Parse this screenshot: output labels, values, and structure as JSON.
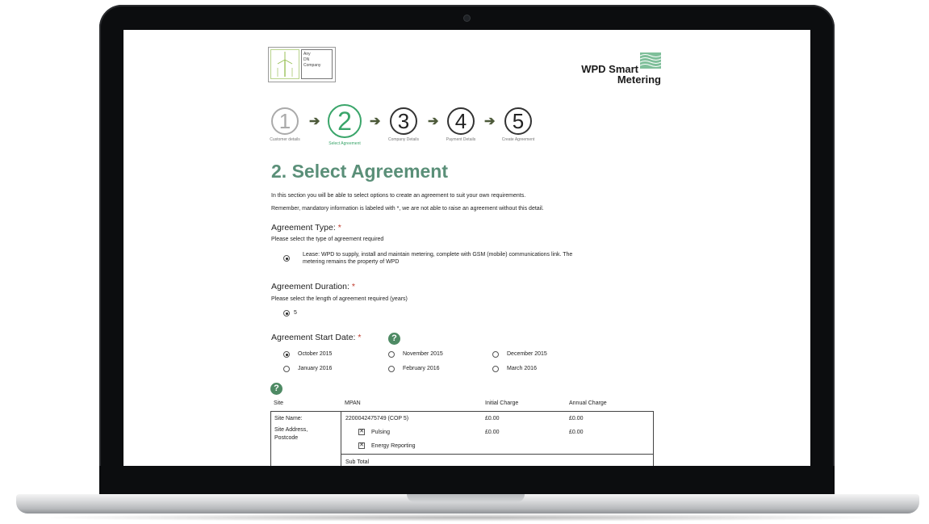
{
  "brand": {
    "left_logo_text": [
      "Any",
      "DN",
      "Company"
    ],
    "right_logo_line1": "WPD Smart",
    "right_logo_line2": "Metering"
  },
  "steps": [
    {
      "num": "1",
      "label": "Customer details",
      "state": "done"
    },
    {
      "num": "2",
      "label": "Select Agreement",
      "state": "active"
    },
    {
      "num": "3",
      "label": "Company Details",
      "state": "todo"
    },
    {
      "num": "4",
      "label": "Payment Details",
      "state": "todo"
    },
    {
      "num": "5",
      "label": "Create Agreement",
      "state": "todo"
    }
  ],
  "page_title": "2. Select Agreement",
  "intro": {
    "line1": "In this section you will be able to select options to create an agreement to suit your own requirements.",
    "line2": "Remember, mandatory information is labeled with *, we are not able to raise an agreement without this detail."
  },
  "agreement_type": {
    "heading": "Agreement Type:",
    "required_mark": "*",
    "prompt": "Please select the type of agreement required",
    "option_line1": "Lease: WPD to supply, install and maintain metering, complete with GSM (mobile) communications link.  The",
    "option_line2": "metering remains the property of WPD"
  },
  "agreement_duration": {
    "heading": "Agreement Duration:",
    "required_mark": "*",
    "prompt": "Please select the length of agreement required (years)",
    "option": "5"
  },
  "start_date": {
    "heading": "Agreement Start Date:",
    "required_mark": "*",
    "options": [
      {
        "label": "October 2015",
        "selected": true
      },
      {
        "label": "November 2015",
        "selected": false
      },
      {
        "label": "December 2015",
        "selected": false
      },
      {
        "label": "January 2016",
        "selected": false
      },
      {
        "label": "February 2016",
        "selected": false
      },
      {
        "label": "March 2016",
        "selected": false
      }
    ]
  },
  "icons": {
    "help": "help-question-icon"
  },
  "table": {
    "headers": [
      "Site",
      "MPAN",
      "Initial Charge",
      "Annual Charge"
    ],
    "site_name_label": "Site Name:",
    "site_address_label1": "Site Address,",
    "site_address_label2": "Postcode",
    "mpan": "2200042475749 (COP 5)",
    "mpan_initial": "£0.00",
    "mpan_annual": "£0.00",
    "services": [
      {
        "label": "Pulsing",
        "checked": true,
        "initial": "£0.00",
        "annual": "£0.00"
      },
      {
        "label": "Energy Reporting",
        "checked": true,
        "initial": "",
        "annual": ""
      }
    ],
    "subtotal_label": "Sub Total"
  },
  "colors": {
    "title_green": "#5a8f78",
    "active_step": "#3aa56a",
    "help_icon": "#4e8a64",
    "required": "#c0392b"
  }
}
